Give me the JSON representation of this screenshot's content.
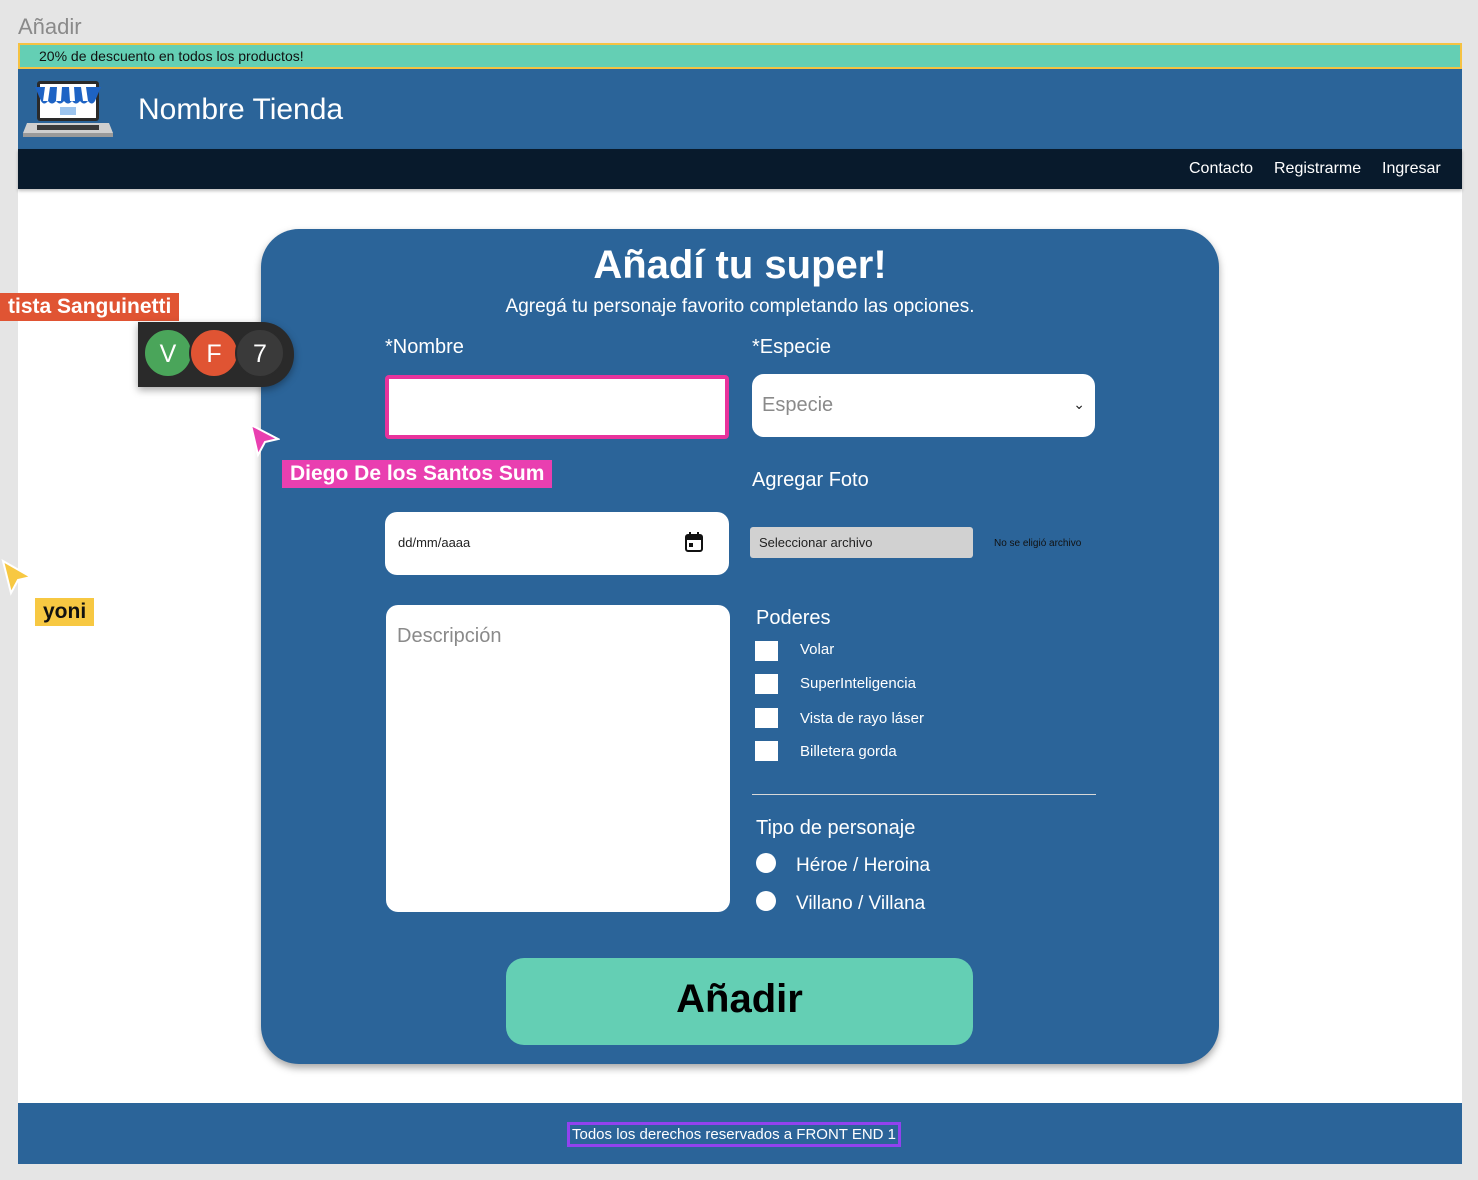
{
  "frame_label": "Añadir",
  "promo": "20% de descuento en todos los productos!",
  "header": {
    "store_name": "Nombre Tienda"
  },
  "nav": [
    "Contacto",
    "Registrarme",
    "Ingresar"
  ],
  "form": {
    "title": "Añadí tu super!",
    "subtitle": "Agregá tu personaje favorito completando las opciones.",
    "nombre_label": "*Nombre",
    "nombre_value": "",
    "especie_label": "*Especie",
    "especie_placeholder": "Especie",
    "foto_label": "Agregar Foto",
    "date_placeholder": "dd/mm/aaaa",
    "file_button": "Seleccionar archivo",
    "file_status": "No se eligió archivo",
    "descripcion_placeholder": "Descripción",
    "poderes_label": "Poderes",
    "poderes": [
      "Volar",
      "SuperInteligencia",
      "Vista de rayo láser",
      "Billetera gorda"
    ],
    "tipo_label": "Tipo de personaje",
    "tipos": [
      "Héroe / Heroina",
      "Villano / Villana"
    ],
    "submit": "Añadir"
  },
  "footer": "Todos los derechos reservados a FRONT END 1",
  "collaborators": {
    "cursor1": {
      "name": "tista Sanguinetti",
      "color": "#e05433"
    },
    "cursor2": {
      "name": "Diego De los Santos Sum",
      "color": "#e93fb0"
    },
    "cursor3": {
      "name": "yoni",
      "color": "#f7c842"
    },
    "avatars": [
      {
        "letter": "V",
        "color": "#4aa55a"
      },
      {
        "letter": "F",
        "color": "#e05433"
      },
      {
        "letter": "7",
        "color": "#3a3a3a"
      }
    ]
  }
}
